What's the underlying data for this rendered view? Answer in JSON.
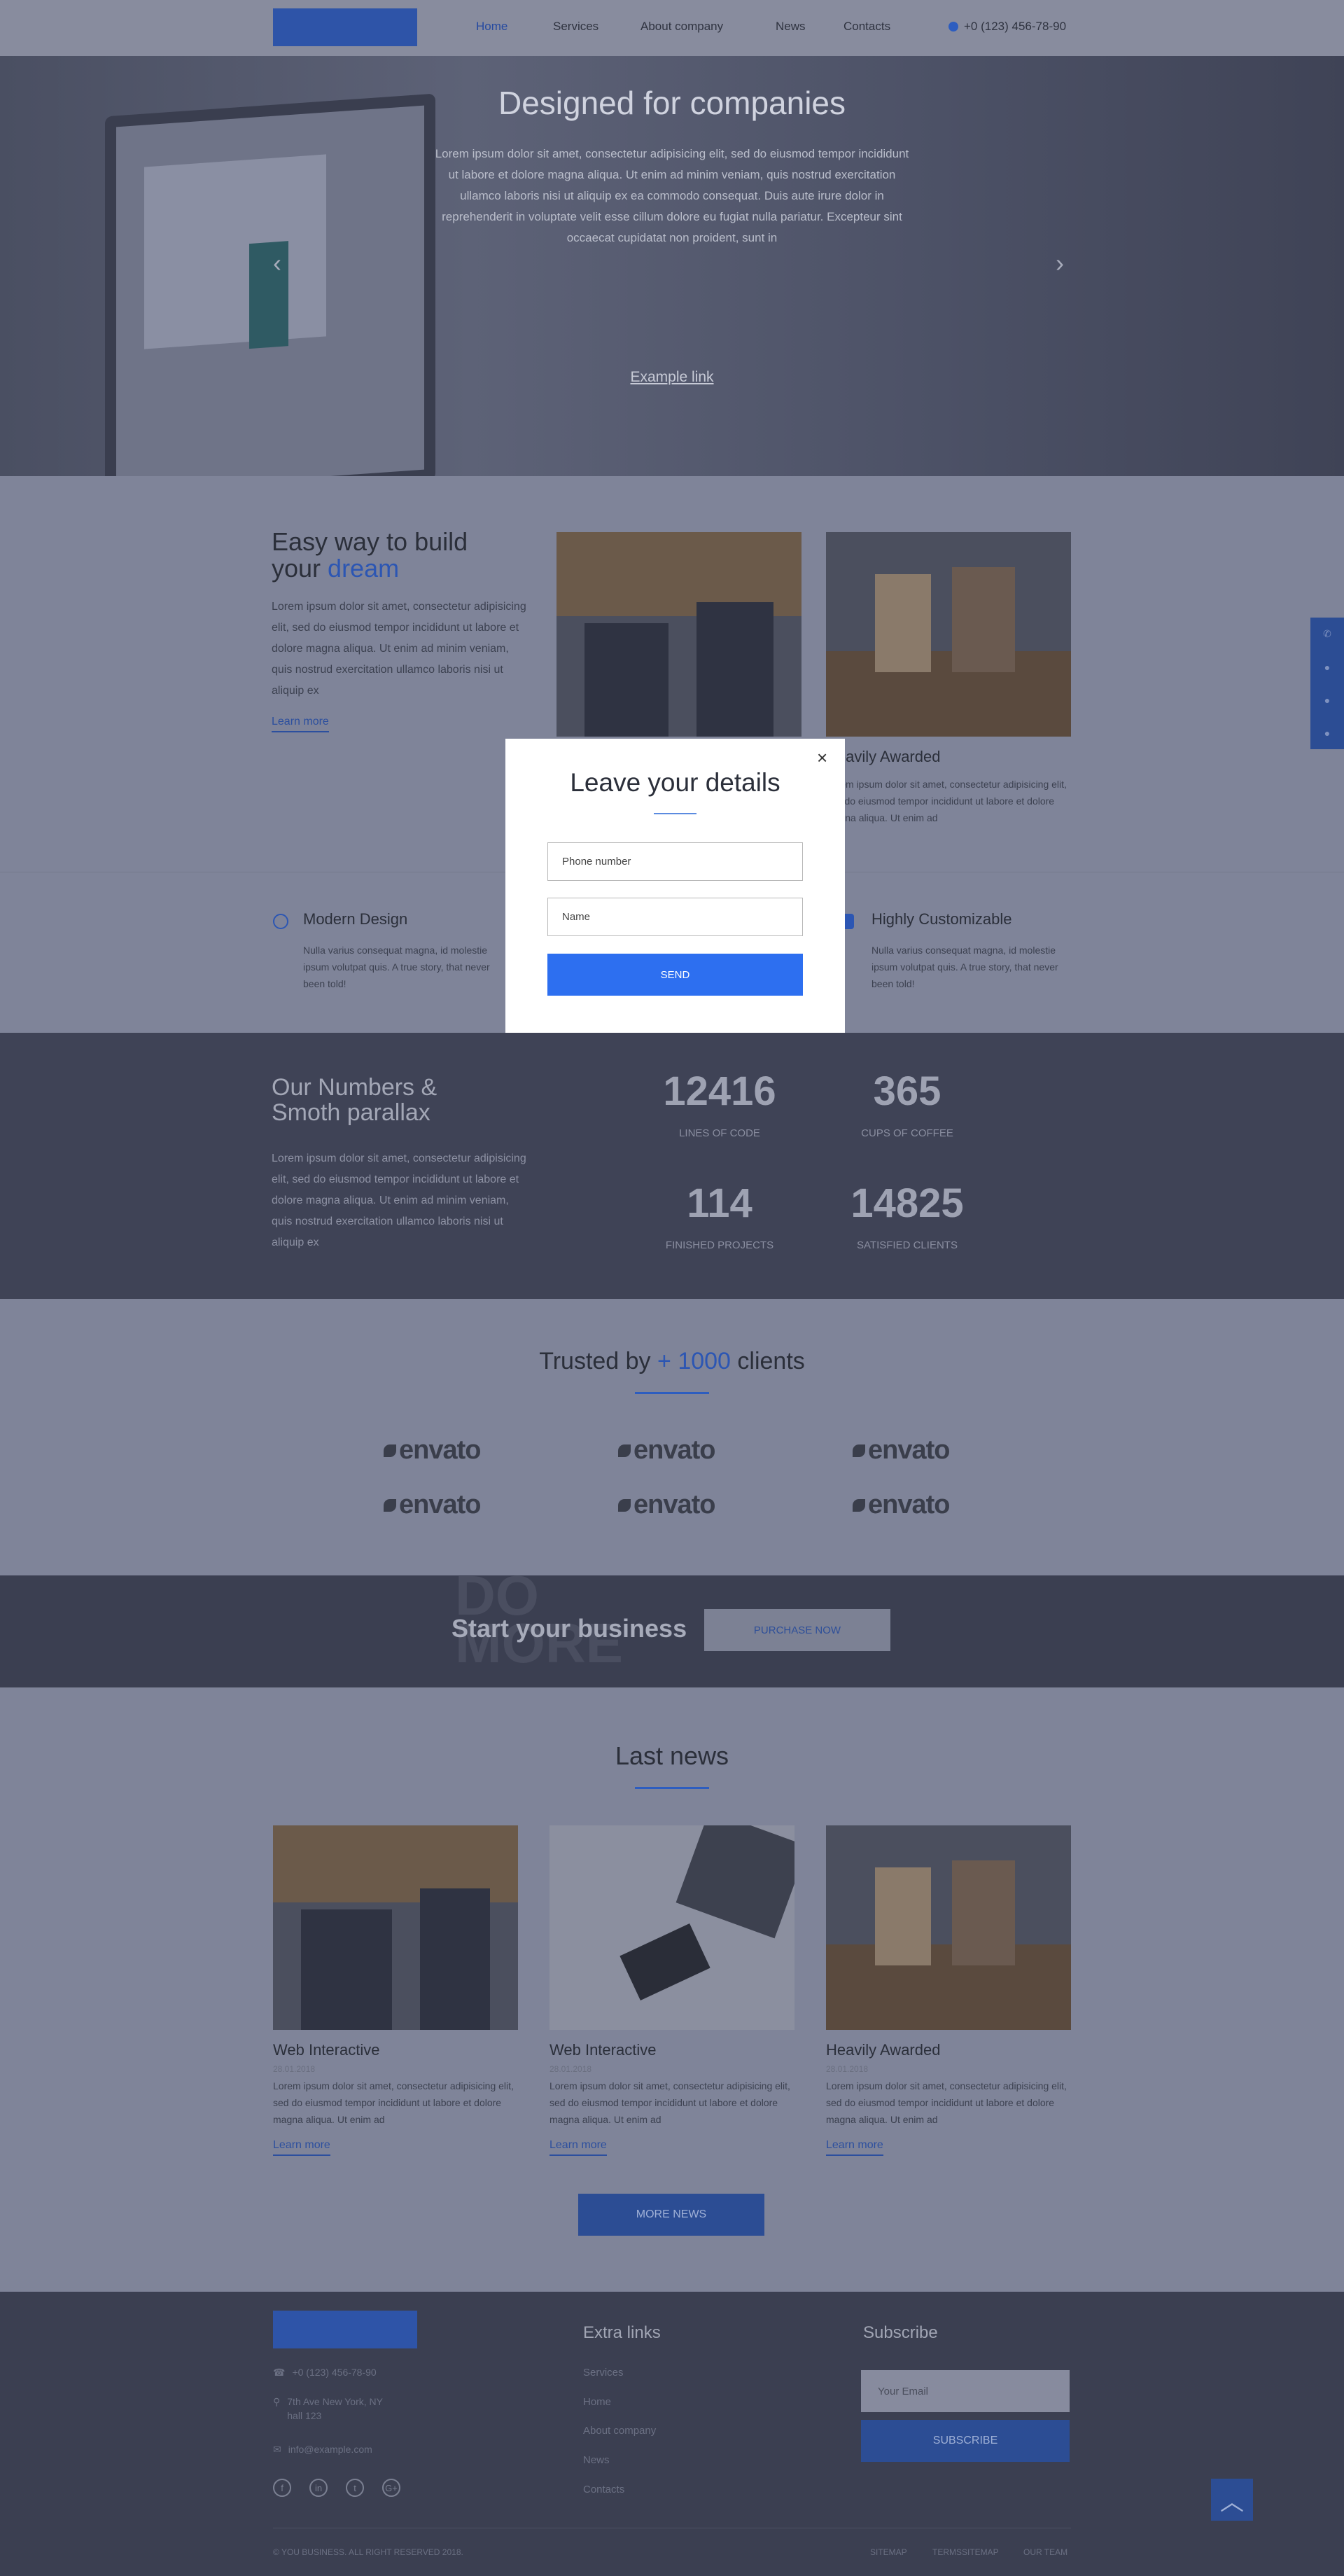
{
  "nav": {
    "items": [
      "Home",
      "Services",
      "About company",
      "News",
      "Contacts"
    ],
    "phone": "+0 (123) 456-78-90"
  },
  "hero": {
    "title": "Designed for companies",
    "text": "Lorem ipsum dolor sit amet, consectetur adipisicing elit, sed do eiusmod tempor incididunt ut labore et dolore magna aliqua. Ut enim ad minim veniam, quis nostrud exercitation ullamco laboris nisi ut aliquip ex ea commodo consequat. Duis aute irure dolor in reprehenderit in voluptate velit esse cillum dolore eu fugiat nulla pariatur. Excepteur sint occaecat cupidatat non proident, sunt in",
    "link": "Example link",
    "prev": "‹",
    "next": "›"
  },
  "about": {
    "title_line1": "Easy way to build",
    "title_line2_a": "your ",
    "title_line2_b": "dream",
    "text": "Lorem ipsum dolor sit amet, consectetur adipisicing elit, sed do eiusmod tempor incididunt ut labore et dolore magna aliqua. Ut enim ad minim veniam, quis nostrud exercitation ullamco laboris nisi ut aliquip ex",
    "learn_more": "Learn more",
    "card_title": "Heavily Awarded",
    "card_text": "Lorem ipsum dolor sit amet, consectetur adipisicing elit, sed do eiusmod tempor incididunt ut labore et dolore magna aliqua. Ut enim ad"
  },
  "features": [
    {
      "title": "Modern Design",
      "text": "Nulla varius consequat magna, id molestie ipsum volutpat quis. A true story, that never been told!"
    },
    {
      "title": "Highly Customizable",
      "text": "Nulla varius consequat magna, id molestie ipsum volutpat quis. A true story, that never been told!"
    }
  ],
  "numbers": {
    "title_line1": "Our Numbers &",
    "title_line2": "Smoth parallax",
    "text": "Lorem ipsum dolor sit amet, consectetur adipisicing elit, sed do eiusmod tempor incididunt ut labore et dolore magna aliqua. Ut enim ad minim veniam, quis nostrud exercitation ullamco laboris nisi ut aliquip ex",
    "stats": [
      {
        "value": "12416",
        "label": "LINES OF CODE"
      },
      {
        "value": "365",
        "label": "CUPS OF COFFEE"
      },
      {
        "value": "114",
        "label": "FINISHED PROJECTS"
      },
      {
        "value": "14825",
        "label": "SATISFIED CLIENTS"
      }
    ]
  },
  "trusted": {
    "prefix": "Trusted by ",
    "count": "+ 1000",
    "suffix": " clients",
    "logo_text": "envato"
  },
  "cta": {
    "title": "Start your business",
    "button": "PURCHASE NOW",
    "bg_line1": "DO",
    "bg_line2": "MORE"
  },
  "news": {
    "title": "Last news",
    "items": [
      {
        "title": "Web Interactive",
        "date": "28.01.2018",
        "text": "Lorem ipsum dolor sit amet, consectetur adipisicing elit, sed do eiusmod tempor incididunt ut labore et dolore magna aliqua. Ut enim ad",
        "link": "Learn more"
      },
      {
        "title": "Web Interactive",
        "date": "28.01.2018",
        "text": "Lorem ipsum dolor sit amet, consectetur adipisicing elit, sed do eiusmod tempor incididunt ut labore et dolore magna aliqua. Ut enim ad",
        "link": "Learn more"
      },
      {
        "title": "Heavily Awarded",
        "date": "28.01.2018",
        "text": "Lorem ipsum dolor sit amet, consectetur adipisicing elit, sed do eiusmod tempor incididunt ut labore et dolore magna aliqua. Ut enim ad",
        "link": "Learn more"
      }
    ],
    "more": "MORE NEWS"
  },
  "footer": {
    "phone": "+0 (123) 456-78-90",
    "address_line1": "7th Ave New York, NY",
    "address_line2": "hall 123",
    "email": "info@example.com",
    "extra_title": "Extra links",
    "links": [
      "Services",
      "Home",
      "About company",
      "News",
      "Contacts"
    ],
    "subscribe_title": "Subscribe",
    "email_placeholder": "Your Email",
    "subscribe_button": "SUBSCRIBE",
    "copyright": "© YOU BUSINESS. ALL RIGHT RESERVED 2018.",
    "bottom_links": [
      "SITEMAP",
      "TERMSSITEMAP",
      "OUR TEAM"
    ],
    "social": [
      "f",
      "in",
      "t",
      "G+"
    ]
  },
  "modal": {
    "title": "Leave your details",
    "phone_placeholder": "Phone number",
    "name_placeholder": "Name",
    "send": "SEND",
    "close": "×"
  },
  "colors": {
    "accent": "#2d6ff0",
    "overlay": "#7f8499"
  }
}
